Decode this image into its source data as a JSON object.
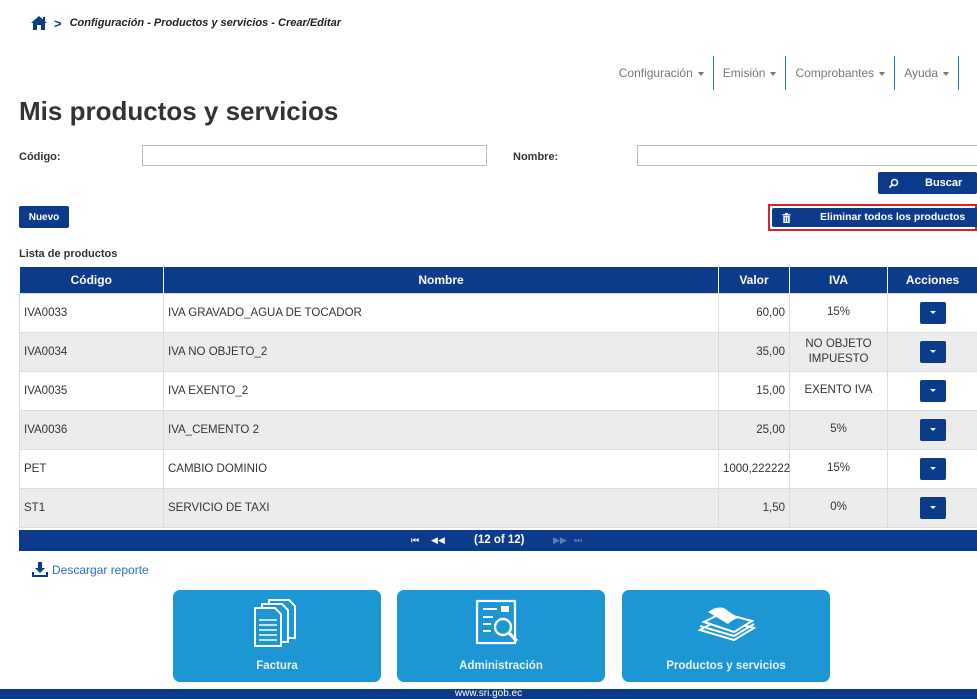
{
  "breadcrumb": {
    "path": "Configuración - Productos y servicios - Crear/Editar"
  },
  "nav": {
    "items": [
      "Configuración",
      "Emisión",
      "Comprobantes",
      "Ayuda"
    ]
  },
  "page": {
    "title": "Mis productos y servicios"
  },
  "filters": {
    "codigo_label": "Código:",
    "codigo_value": "",
    "nombre_label": "Nombre:",
    "nombre_value": "",
    "buscar_label": "Buscar"
  },
  "actions": {
    "nuevo_label": "Nuevo",
    "eliminar_label": "Eliminar todos los productos"
  },
  "list": {
    "title": "Lista de productos",
    "headers": [
      "Código",
      "Nombre",
      "Valor",
      "IVA",
      "Acciones"
    ],
    "rows": [
      {
        "codigo": "IVA0033",
        "nombre": "IVA GRAVADO_AGUA DE TOCADOR",
        "valor": "60,00",
        "iva": "15%"
      },
      {
        "codigo": "IVA0034",
        "nombre": "IVA NO OBJETO_2",
        "valor": "35,00",
        "iva": "NO OBJETO IMPUESTO"
      },
      {
        "codigo": "IVA0035",
        "nombre": "IVA EXENTO_2",
        "valor": "15,00",
        "iva": "EXENTO IVA"
      },
      {
        "codigo": "IVA0036",
        "nombre": "IVA_CEMENTO 2",
        "valor": "25,00",
        "iva": "5%"
      },
      {
        "codigo": "PET",
        "nombre": "CAMBIO DOMINIO",
        "valor": "1000,222222",
        "iva": "15%"
      },
      {
        "codigo": "ST1",
        "nombre": "SERVICIO DE TAXI",
        "valor": "1,50",
        "iva": "0%"
      }
    ]
  },
  "pager": {
    "current": "(12 of 12)",
    "first": "⏮",
    "prev": "◀◀",
    "next": "▶▶",
    "last": "⏭"
  },
  "download": {
    "label": "Descargar reporte"
  },
  "tiles": [
    {
      "label": "Factura",
      "icon": "documents-icon"
    },
    {
      "label": "Administración",
      "icon": "document-search-icon"
    },
    {
      "label": "Productos y servicios",
      "icon": "paper-stack-icon"
    }
  ],
  "footer": {
    "text": "www.sri.gob.ec"
  },
  "colors": {
    "primary": "#0d3b8c",
    "tile": "#1d96d4",
    "highlight_border": "#d9222a",
    "link": "#2b6fbf"
  }
}
